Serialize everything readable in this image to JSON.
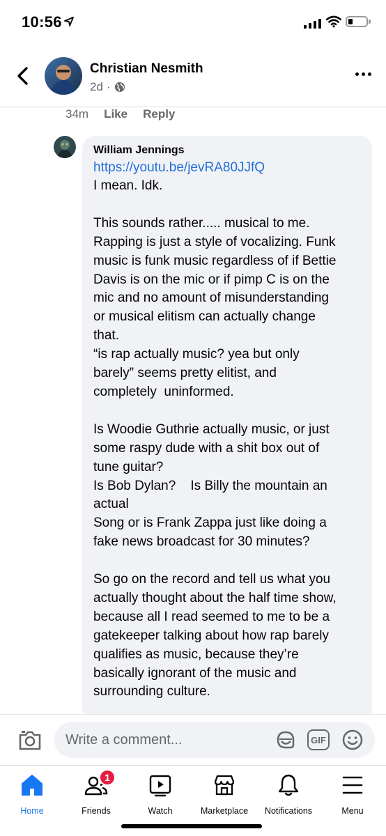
{
  "status_bar": {
    "time": "10:56"
  },
  "post_header": {
    "author": "Christian Nesmith",
    "age": "2d",
    "separator": "·"
  },
  "previous_comment": {
    "time": "34m",
    "like_label": "Like",
    "reply_label": "Reply"
  },
  "comment": {
    "author": "William Jennings",
    "link": "https://youtu.be/jevRA80JJfQ",
    "body": "I mean. Idk.\n\nThis sounds rather..... musical to me.\nRapping is just a style of vocalizing. Funk\nmusic is funk music regardless of if Bettie\nDavis is on the mic or if pimp C is on the\nmic and no amount of misunderstanding\nor musical elitism can actually change\nthat.\n“is rap actually music? yea but only\nbarely” seems pretty elitist, and\ncompletely  uninformed.\n\nIs Woodie Guthrie actually music, or just\nsome raspy dude with a shit box out of\ntune guitar?\nIs Bob Dylan?    Is Billy the mountain an\nactual\nSong or is Frank Zappa just like doing a\nfake news broadcast for 30 minutes?\n\nSo go on the record and tell us what you\nactually thought about the half time show,\nbecause all I read seemed to me to be a\ngatekeeper talking about how rap barely\nqualifies as music, because they’re\nbasically ignorant of the music and\nsurrounding culture."
  },
  "composer": {
    "placeholder": "Write a comment...",
    "gif_label": "GIF"
  },
  "tabs": [
    {
      "label": "Home",
      "icon": "home-icon",
      "active": true
    },
    {
      "label": "Friends",
      "icon": "friends-icon",
      "badge": "1"
    },
    {
      "label": "Watch",
      "icon": "watch-icon"
    },
    {
      "label": "Marketplace",
      "icon": "marketplace-icon"
    },
    {
      "label": "Notifications",
      "icon": "bell-icon"
    },
    {
      "label": "Menu",
      "icon": "menu-icon"
    }
  ],
  "colors": {
    "accent": "#1877f2",
    "link": "#216fdb",
    "badge": "#e41e3f",
    "bubble": "#f0f2f5",
    "secondary_text": "#65676b"
  }
}
